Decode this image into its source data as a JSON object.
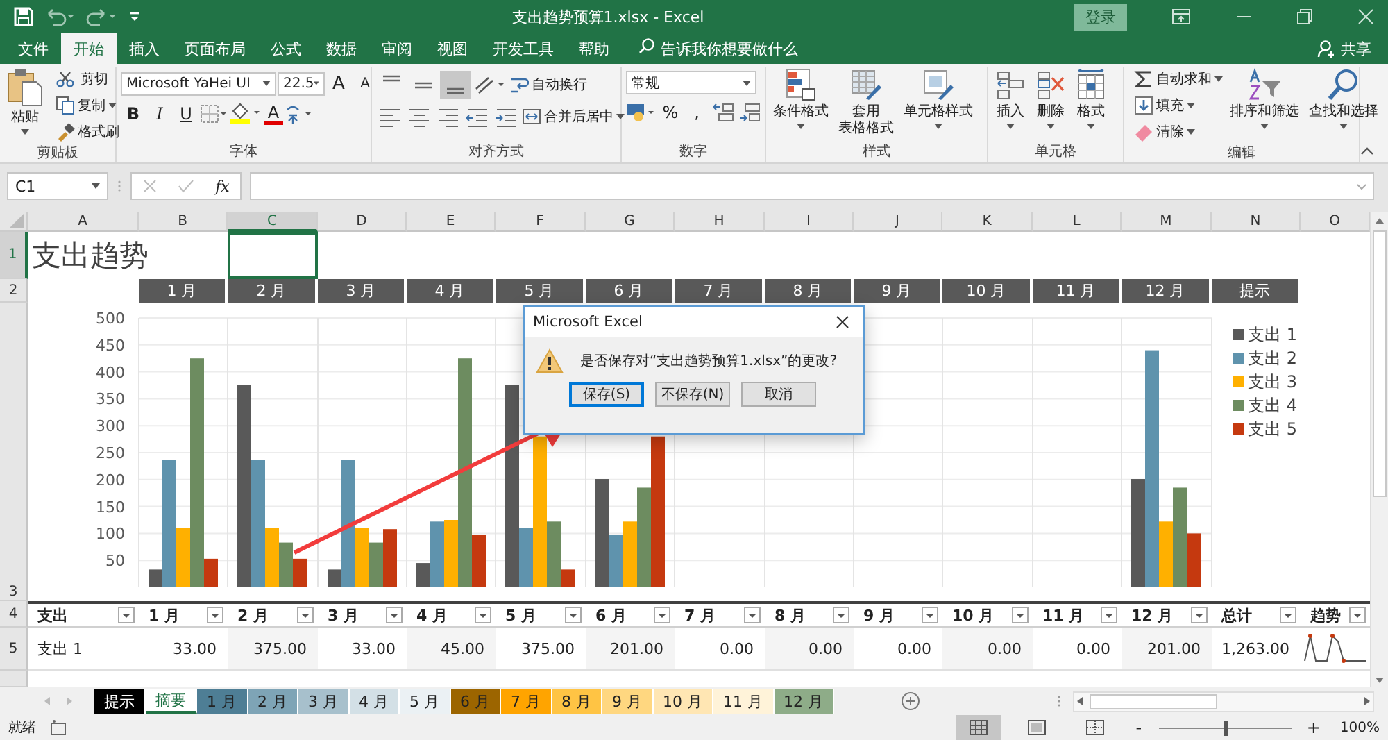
{
  "title_bar": {
    "title": "支出趋势预算1.xlsx  -  Excel",
    "login": "登录"
  },
  "menu_tabs": [
    {
      "label": "文件",
      "selected": false
    },
    {
      "label": "开始",
      "selected": true
    },
    {
      "label": "插入",
      "selected": false
    },
    {
      "label": "页面布局",
      "selected": false
    },
    {
      "label": "公式",
      "selected": false
    },
    {
      "label": "数据",
      "selected": false
    },
    {
      "label": "审阅",
      "selected": false
    },
    {
      "label": "视图",
      "selected": false
    },
    {
      "label": "开发工具",
      "selected": false
    },
    {
      "label": "帮助",
      "selected": false
    }
  ],
  "tell_me": "告诉我你想要做什么",
  "share": "共享",
  "ribbon": {
    "clipboard": {
      "paste": "粘贴",
      "cut": "剪切",
      "copy": "复制",
      "format_painter": "格式刷",
      "label": "剪贴板"
    },
    "font": {
      "font_name": "Microsoft YaHei UI",
      "font_size": "22.5",
      "grow": "A",
      "shrink": "A",
      "bold": "B",
      "italic": "I",
      "underline": "U",
      "font_color": "A",
      "label": "字体"
    },
    "alignment": {
      "vertical": [
        {
          "selected": false
        },
        {
          "selected": false
        },
        {
          "selected": true
        }
      ],
      "wrap": "自动换行",
      "merge": "合并后居中",
      "label": "对齐方式"
    },
    "number": {
      "format": "常规",
      "percent": "%",
      "comma": ",",
      "label": "数字"
    },
    "styles": {
      "conditional": "条件格式",
      "table_format": [
        "套用",
        "表格格式"
      ],
      "cell_styles": "单元格样式",
      "label": "样式"
    },
    "cells": {
      "insert": "插入",
      "delete": "删除",
      "format": "格式",
      "label": "单元格"
    },
    "editing": {
      "autosum": "自动求和",
      "fill": "填充",
      "clear": "清除",
      "sort": "排序和筛选",
      "find": "查找和选择",
      "label": "编辑"
    }
  },
  "formula_bar": {
    "name_box": "C1",
    "function": "fx"
  },
  "sheet": {
    "columns": [
      {
        "label": "A",
        "selected": false
      },
      {
        "label": "B",
        "selected": false
      },
      {
        "label": "C",
        "selected": true
      },
      {
        "label": "D",
        "selected": false
      },
      {
        "label": "E",
        "selected": false
      },
      {
        "label": "F",
        "selected": false
      },
      {
        "label": "G",
        "selected": false
      },
      {
        "label": "H",
        "selected": false
      },
      {
        "label": "I",
        "selected": false
      },
      {
        "label": "J",
        "selected": false
      },
      {
        "label": "K",
        "selected": false
      },
      {
        "label": "L",
        "selected": false
      },
      {
        "label": "M",
        "selected": false
      },
      {
        "label": "N",
        "selected": false
      },
      {
        "label": "O",
        "selected": false
      }
    ],
    "rows": [
      {
        "label": "1",
        "selected": true
      },
      {
        "label": "2",
        "selected": false
      },
      {
        "label": "3",
        "selected": false
      },
      {
        "label": "4",
        "selected": false
      },
      {
        "label": "5",
        "selected": false
      }
    ],
    "title": "支出趋势",
    "month_headers": [
      "1 月",
      "2 月",
      "3 月",
      "4 月",
      "5 月",
      "6 月",
      "7 月",
      "8 月",
      "9 月",
      "10 月",
      "11 月",
      "12 月",
      "提示"
    ],
    "chart_data": {
      "type": "bar",
      "grid": true,
      "legend": true,
      "ylim": [
        0,
        500
      ],
      "yticks": [
        50,
        100,
        150,
        200,
        250,
        300,
        350,
        400,
        450,
        500
      ],
      "series": [
        {
          "name": "支出 1",
          "color": "#595959",
          "values": [
            33,
            375,
            33,
            45,
            375,
            201,
            0,
            0,
            0,
            0,
            0,
            201
          ]
        },
        {
          "name": "支出 2",
          "color": "#5f93ad",
          "values": [
            237,
            237,
            237,
            122,
            110,
            97,
            0,
            0,
            0,
            0,
            0,
            440
          ]
        },
        {
          "name": "支出 3",
          "color": "#ffb000",
          "values": [
            110,
            110,
            110,
            125,
            280,
            122,
            0,
            0,
            0,
            0,
            0,
            122
          ]
        },
        {
          "name": "支出 4",
          "color": "#6d8c60",
          "values": [
            425,
            83,
            83,
            425,
            122,
            185,
            0,
            0,
            0,
            0,
            0,
            185
          ]
        },
        {
          "name": "支出 5",
          "color": "#c5390f",
          "values": [
            53,
            53,
            108,
            97,
            33,
            280,
            0,
            0,
            0,
            0,
            0,
            100
          ]
        }
      ]
    },
    "table_headers": [
      "支出",
      "1 月",
      "2 月",
      "3 月",
      "4 月",
      "5 月",
      "6 月",
      "7 月",
      "8 月",
      "9 月",
      "10 月",
      "11 月",
      "12 月",
      "总计",
      "趋势"
    ],
    "table_rows": [
      {
        "name": "支出 1",
        "values": [
          "33.00",
          "375.00",
          "33.00",
          "45.00",
          "375.00",
          "201.00",
          "0.00",
          "0.00",
          "0.00",
          "0.00",
          "0.00",
          "201.00"
        ],
        "total": "1,263.00"
      }
    ]
  },
  "dialog": {
    "title": "Microsoft Excel",
    "message": "是否保存对“支出趋势预算1.xlsx”的更改?",
    "buttons": [
      {
        "label": "保存(S)",
        "selected": true
      },
      {
        "label": "不保存(N)",
        "selected": false
      },
      {
        "label": "取消",
        "selected": false
      }
    ]
  },
  "sheet_tabs": [
    {
      "label": "提示",
      "color": "#000000",
      "selected": false
    },
    {
      "label": "摘要",
      "color": "#217346",
      "selected": true
    },
    {
      "label": "1 月",
      "color": "#4e7e95",
      "selected": false
    },
    {
      "label": "2 月",
      "color": "#7ea4b6",
      "selected": false
    },
    {
      "label": "3 月",
      "color": "#a7c0cc",
      "selected": false
    },
    {
      "label": "4 月",
      "color": "#d3e0e6",
      "selected": false
    },
    {
      "label": "5 月",
      "color": "#ebf1f4",
      "selected": false
    },
    {
      "label": "6 月",
      "color": "#9c6500",
      "selected": false
    },
    {
      "label": "7 月",
      "color": "#ffa400",
      "selected": false
    },
    {
      "label": "8 月",
      "color": "#ffc444",
      "selected": false
    },
    {
      "label": "9 月",
      "color": "#ffd780",
      "selected": false
    },
    {
      "label": "10 月",
      "color": "#ffe6b3",
      "selected": false
    },
    {
      "label": "11 月",
      "color": "#fff3d9",
      "selected": false
    },
    {
      "label": "12 月",
      "color": "#8eac88",
      "selected": false
    }
  ],
  "status_bar": {
    "status": "就绪",
    "views": [
      {
        "selected": true
      },
      {
        "selected": false
      },
      {
        "selected": false
      }
    ],
    "zoom_out": "-",
    "zoom_slider": {
      "level": 0.5
    },
    "zoom_in": "+",
    "zoom": "100%"
  }
}
